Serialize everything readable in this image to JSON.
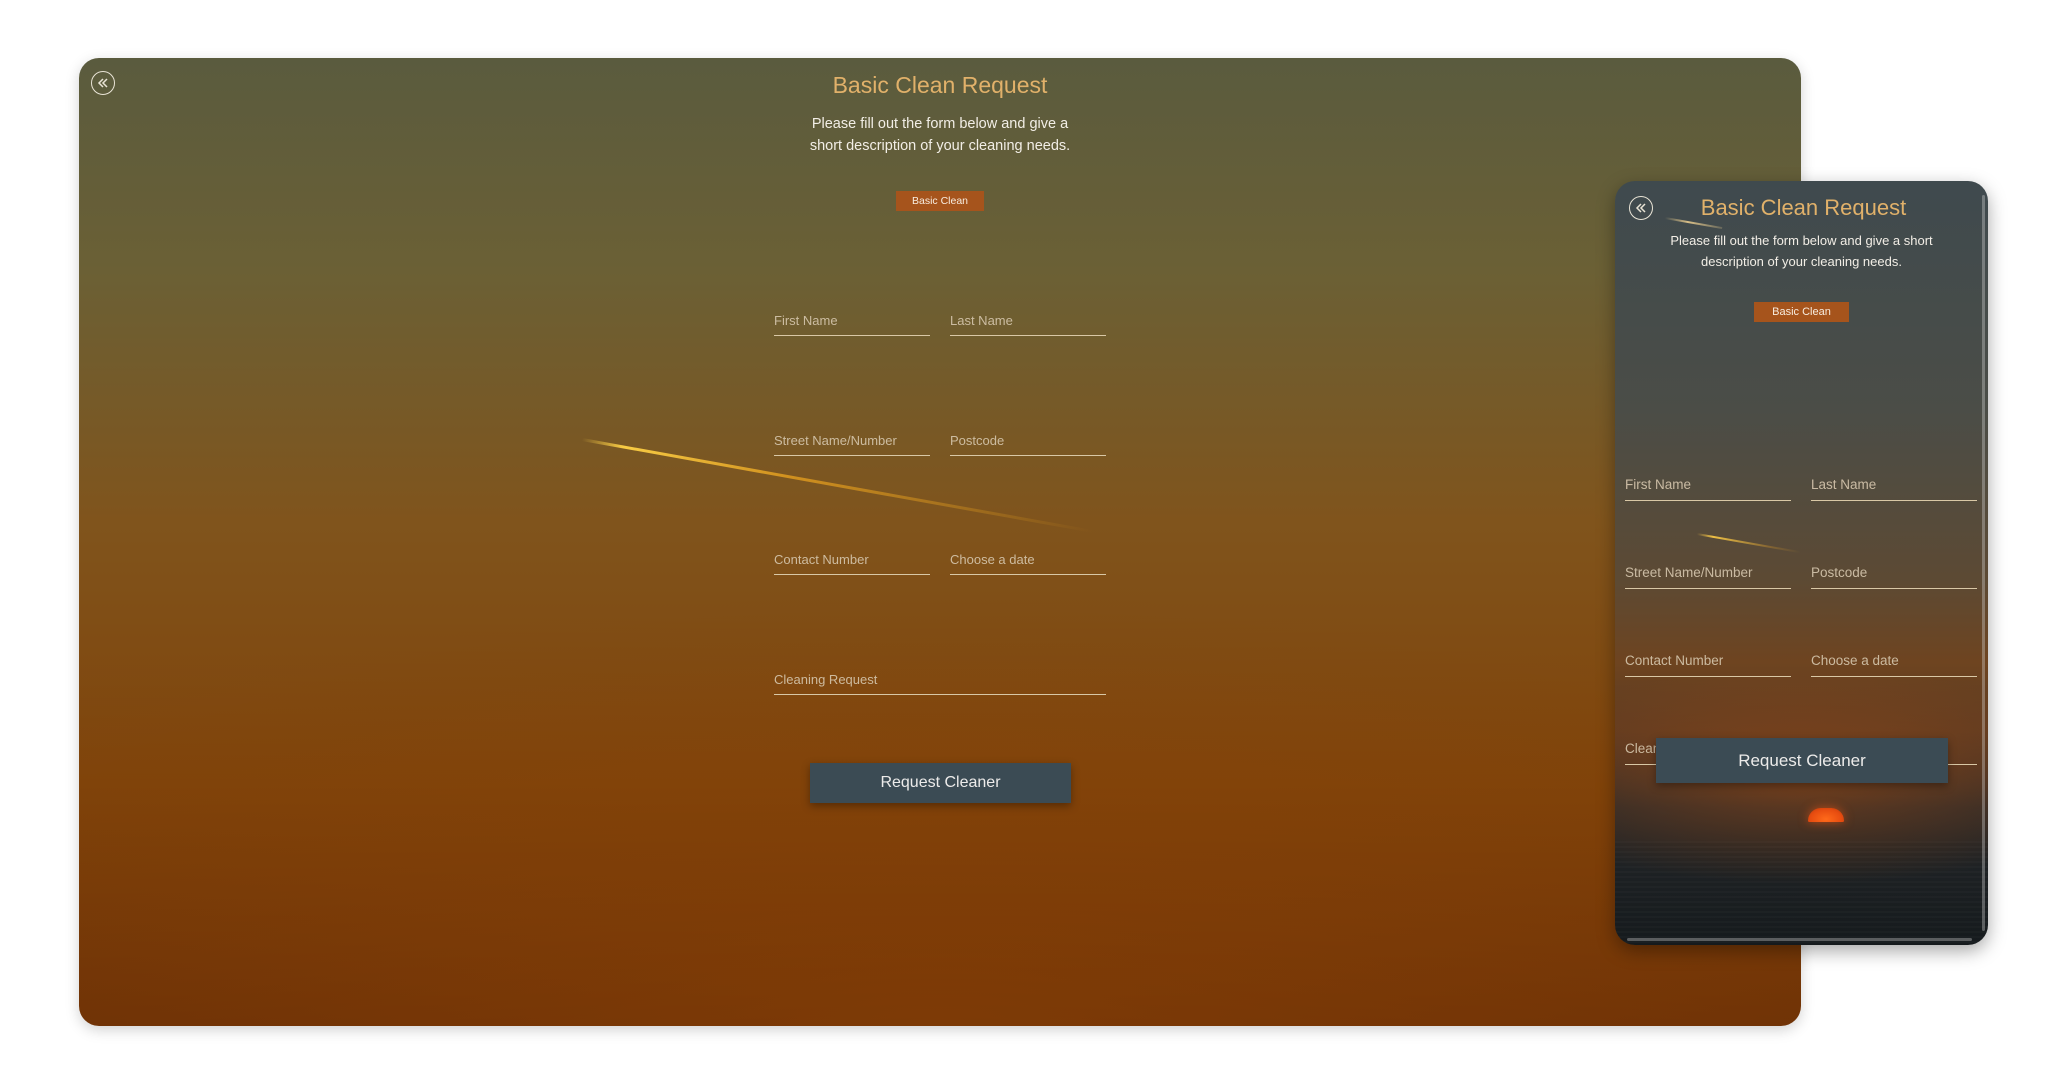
{
  "form": {
    "title": "Basic Clean Request",
    "subtitle": "Please fill out the form below and give a short description of your cleaning needs.",
    "badge": "Basic Clean",
    "fields": {
      "first_name": "First Name",
      "last_name": "Last Name",
      "street": "Street Name/Number",
      "postcode": "Postcode",
      "contact": "Contact Number",
      "date": "Choose a date",
      "request": "Cleaning Request"
    },
    "submit_label": "Request Cleaner"
  },
  "icons": {
    "back": "double-chevron-left-icon"
  },
  "colors": {
    "title": "#e1b16a",
    "badge": "#a6541c",
    "button": "#3b4b54"
  }
}
